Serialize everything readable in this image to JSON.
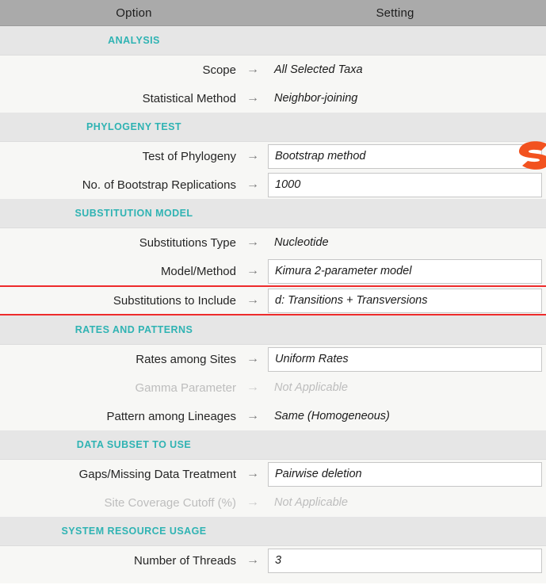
{
  "header": {
    "option_label": "Option",
    "setting_label": "Setting"
  },
  "colors": {
    "header_bg": "#aaaaaa",
    "section_bg": "#e6e6e6",
    "row_bg": "#f7f7f5",
    "section_title": "#2fb3b3",
    "highlight_rule": "#ee2b2b",
    "logo_orange": "#f2521f"
  },
  "arrow_glyph": "→",
  "logo": {
    "name": "orange-s-logo"
  },
  "sections": [
    {
      "title": "ANALYSIS",
      "rows": [
        {
          "label": "Scope",
          "value": "All Selected Taxa",
          "boxed": false,
          "disabled": false,
          "highlight": false
        },
        {
          "label": "Statistical Method",
          "value": "Neighbor-joining",
          "boxed": false,
          "disabled": false,
          "highlight": false
        }
      ]
    },
    {
      "title": "PHYLOGENY TEST",
      "rows": [
        {
          "label": "Test of Phylogeny",
          "value": "Bootstrap method",
          "boxed": true,
          "disabled": false,
          "highlight": false
        },
        {
          "label": "No. of Bootstrap Replications",
          "value": "1000",
          "boxed": true,
          "disabled": false,
          "highlight": false
        }
      ]
    },
    {
      "title": "SUBSTITUTION MODEL",
      "rows": [
        {
          "label": "Substitutions Type",
          "value": "Nucleotide",
          "boxed": false,
          "disabled": false,
          "highlight": false
        },
        {
          "label": "Model/Method",
          "value": "Kimura 2-parameter model",
          "boxed": true,
          "disabled": false,
          "highlight": false
        },
        {
          "label": "Substitutions to Include",
          "value": "d: Transitions + Transversions",
          "boxed": true,
          "disabled": false,
          "highlight": true
        }
      ]
    },
    {
      "title": "RATES AND PATTERNS",
      "rows": [
        {
          "label": "Rates among Sites",
          "value": "Uniform Rates",
          "boxed": true,
          "disabled": false,
          "highlight": false
        },
        {
          "label": "Gamma Parameter",
          "value": "Not Applicable",
          "boxed": false,
          "disabled": true,
          "highlight": false
        },
        {
          "label": "Pattern among Lineages",
          "value": "Same (Homogeneous)",
          "boxed": false,
          "disabled": false,
          "highlight": false
        }
      ]
    },
    {
      "title": "DATA SUBSET TO USE",
      "rows": [
        {
          "label": "Gaps/Missing Data Treatment",
          "value": "Pairwise deletion",
          "boxed": true,
          "disabled": false,
          "highlight": false
        },
        {
          "label": "Site Coverage Cutoff (%)",
          "value": "Not Applicable",
          "boxed": false,
          "disabled": true,
          "highlight": false
        }
      ]
    },
    {
      "title": "SYSTEM RESOURCE USAGE",
      "rows": [
        {
          "label": "Number of Threads",
          "value": "3",
          "boxed": true,
          "disabled": false,
          "highlight": false
        }
      ]
    }
  ]
}
